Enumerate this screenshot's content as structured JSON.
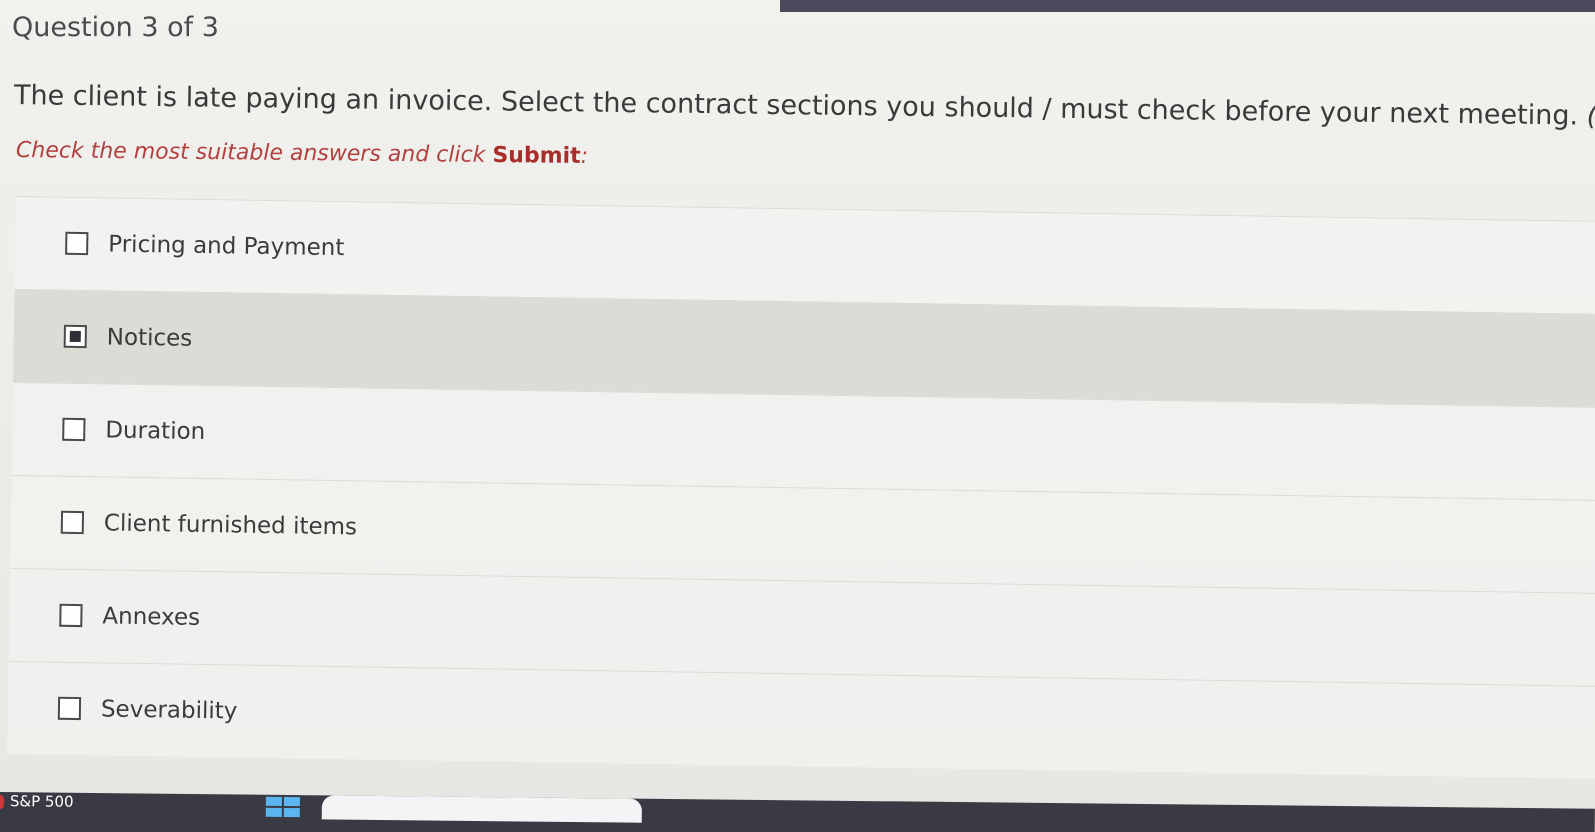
{
  "header": {
    "question_counter": "Question 3 of 3"
  },
  "question": {
    "text": "The client is late paying an invoice. Select the contract sections you should / must check before your next meeting.",
    "hint": "(Select"
  },
  "instruction": {
    "prefix": "Check the most suitable answers and click ",
    "submit_word": "Submit",
    "suffix": ":"
  },
  "options": [
    {
      "label": "Pricing and Payment",
      "checked": false
    },
    {
      "label": "Notices",
      "checked": true
    },
    {
      "label": "Duration",
      "checked": false
    },
    {
      "label": "Client furnished items",
      "checked": false
    },
    {
      "label": "Annexes",
      "checked": false
    },
    {
      "label": "Severability",
      "checked": false
    }
  ],
  "taskbar": {
    "ticker_label": "S&P 500"
  }
}
